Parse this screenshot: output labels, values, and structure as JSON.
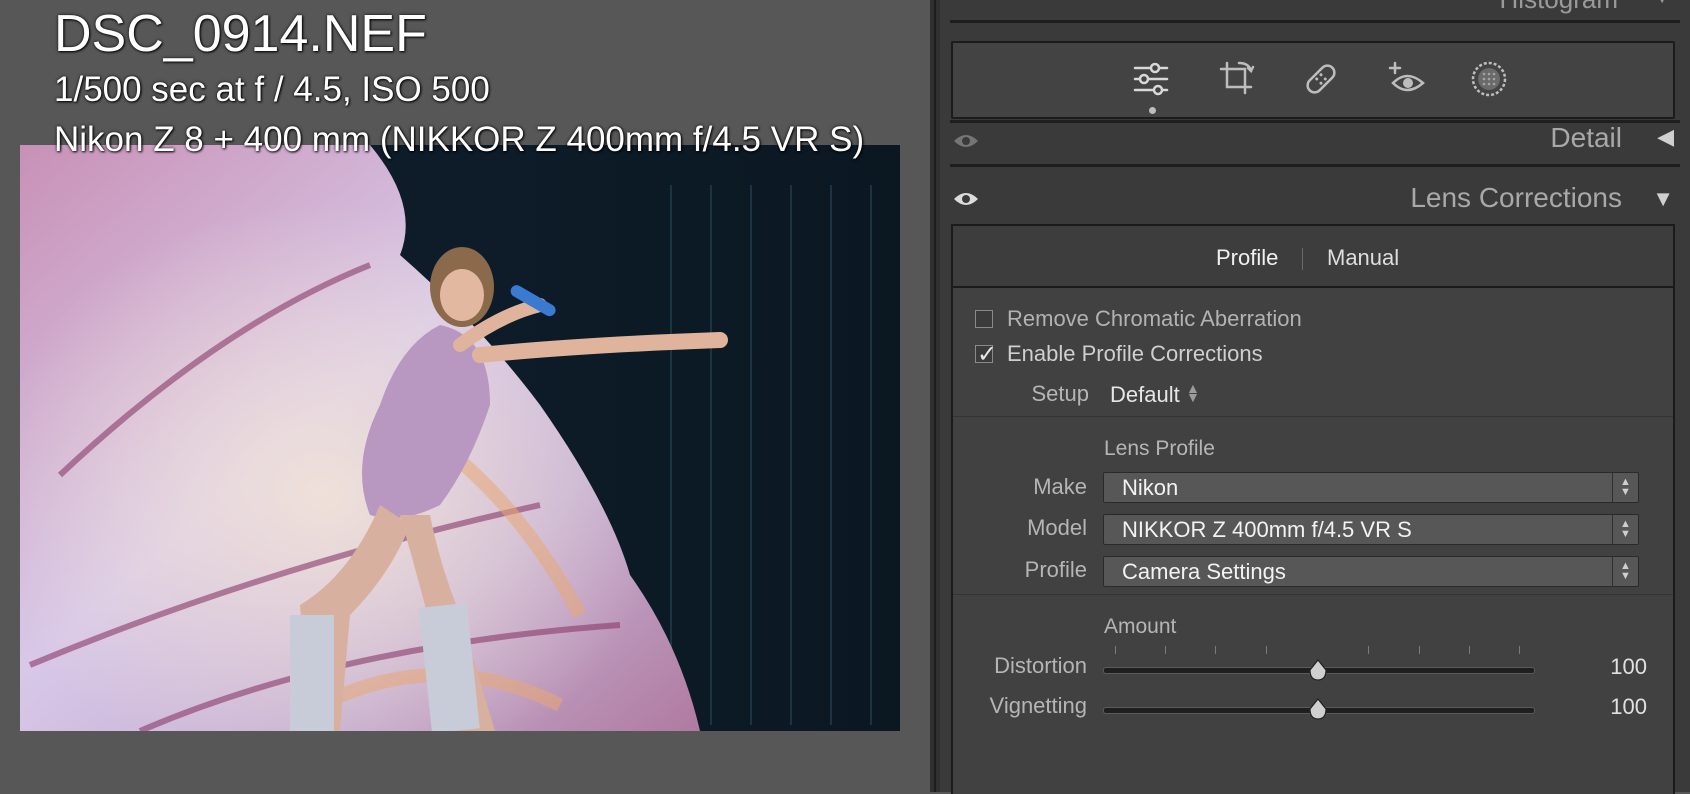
{
  "photo": {
    "file_name": "DSC_0914.NEF",
    "exposure_info": "1/500 sec at f / 4.5, ISO 500",
    "camera_lens": "Nikon Z 8 + 400 mm (NIKKOR Z 400mm f/4.5 VR S)"
  },
  "panel": {
    "histogram_label": "Histogram",
    "tools": [
      "edit-sliders-icon",
      "crop-icon",
      "healing-bandage-icon",
      "red-eye-icon",
      "masking-icon"
    ],
    "detail_section": {
      "title": "Detail",
      "arrow": "◀"
    },
    "lens_section": {
      "title": "Lens Corrections",
      "arrow": "▼",
      "tabs": [
        {
          "label": "Profile",
          "active": true
        },
        {
          "label": "Manual",
          "active": false
        }
      ],
      "remove_ca": {
        "label": "Remove Chromatic Aberration",
        "checked": false
      },
      "enable_profile": {
        "label": "Enable Profile Corrections",
        "checked": true
      },
      "setup": {
        "label": "Setup",
        "value": "Default"
      },
      "lens_profile": {
        "title": "Lens Profile",
        "make": {
          "label": "Make",
          "value": "Nikon"
        },
        "model": {
          "label": "Model",
          "value": "NIKKOR Z 400mm f/4.5 VR S"
        },
        "profile": {
          "label": "Profile",
          "value": "Camera Settings"
        }
      },
      "amount": {
        "title": "Amount",
        "distortion": {
          "label": "Distortion",
          "value": "100",
          "fraction": 0.5
        },
        "vignetting": {
          "label": "Vignetting",
          "value": "100",
          "fraction": 0.5
        }
      }
    }
  },
  "colors": {
    "panel_bg": "#3a3a3a",
    "page_bg": "#575757",
    "text_light": "#e6e6e6"
  }
}
